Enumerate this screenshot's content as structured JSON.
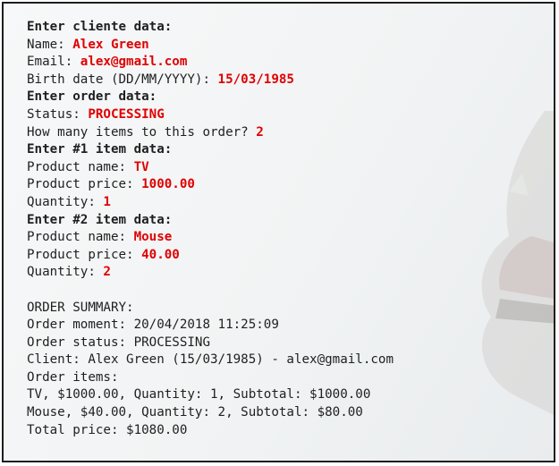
{
  "console": {
    "lines": [
      {
        "label": "Enter cliente data:",
        "value": "",
        "bold": true
      },
      {
        "label": "Name: ",
        "value": "Alex Green"
      },
      {
        "label": "Email: ",
        "value": "alex@gmail.com"
      },
      {
        "label": "Birth date (DD/MM/YYYY): ",
        "value": "15/03/1985"
      },
      {
        "label": "Enter order data:",
        "value": "",
        "bold": true
      },
      {
        "label": "Status: ",
        "value": "PROCESSING"
      },
      {
        "label": "How many items to this order? ",
        "value": "2"
      },
      {
        "label": "Enter #1 item data:",
        "value": "",
        "bold": true
      },
      {
        "label": "Product name: ",
        "value": "TV"
      },
      {
        "label": "Product price: ",
        "value": "1000.00"
      },
      {
        "label": "Quantity: ",
        "value": "1"
      },
      {
        "label": "Enter #2 item data:",
        "value": "",
        "bold": true
      },
      {
        "label": "Product name: ",
        "value": "Mouse"
      },
      {
        "label": "Product price: ",
        "value": "40.00"
      },
      {
        "label": "Quantity: ",
        "value": "2"
      },
      {
        "label": "",
        "value": ""
      },
      {
        "label": "ORDER SUMMARY:",
        "value": ""
      },
      {
        "label": "Order moment: 20/04/2018 11:25:09",
        "value": ""
      },
      {
        "label": "Order status: PROCESSING",
        "value": ""
      },
      {
        "label": "Client: Alex Green (15/03/1985) - alex@gmail.com",
        "value": ""
      },
      {
        "label": "Order items:",
        "value": ""
      },
      {
        "label": "TV, $1000.00, Quantity: 1, Subtotal: $1000.00",
        "value": ""
      },
      {
        "label": "Mouse, $40.00, Quantity: 2, Subtotal: $80.00",
        "value": ""
      },
      {
        "label": "Total price: $1080.00",
        "value": ""
      }
    ]
  },
  "colors": {
    "text": "#1f1f1f",
    "input": "#e00000",
    "border": "#1e1e1e"
  }
}
